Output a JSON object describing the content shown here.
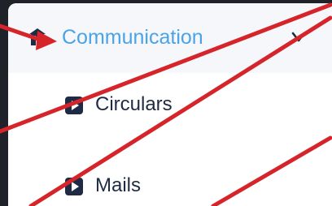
{
  "menu": {
    "header": {
      "label": "Communication",
      "icon": "building-icon",
      "accent_color": "#4aa3e6",
      "expanded": true
    },
    "items": [
      {
        "label": "Circulars",
        "icon": "play-square-icon"
      },
      {
        "label": "Mails",
        "icon": "play-square-icon"
      }
    ]
  },
  "annotation": {
    "color": "#d6252a",
    "marks": [
      "arrow",
      "strike-line",
      "strike-line",
      "strike-line",
      "strike-line"
    ]
  }
}
